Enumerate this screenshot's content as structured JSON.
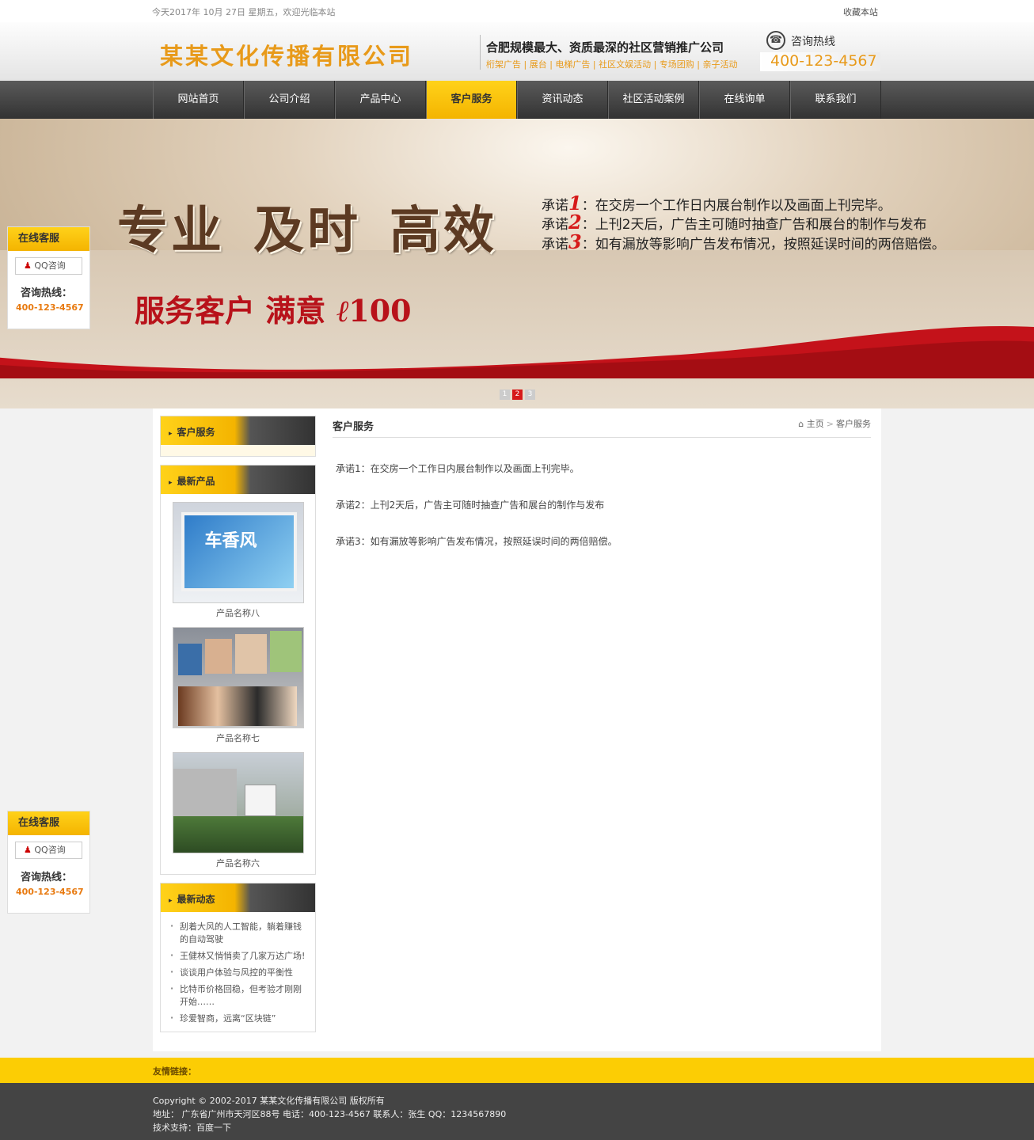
{
  "topbar": {
    "welcome": "今天2017年 10月 27日 星期五，欢迎光临本站",
    "favorite": "收藏本站"
  },
  "header": {
    "logo": "某某文化传播有限公司",
    "slogan_main": "合肥规模最大、资质最深的社区营销推广公司",
    "slogan_sub": "桁架广告 | 展台 | 电梯广告 | 社区文娱活动 | 专场团购 | 亲子活动",
    "hotline_label": "咨询热线",
    "hotline_number": "400-123-4567"
  },
  "nav": [
    "网站首页",
    "公司介绍",
    "产品中心",
    "客户服务",
    "资讯动态",
    "社区活动案例",
    "在线询单",
    "联系我们"
  ],
  "nav_active": "客户服务",
  "banner": {
    "big_words": [
      "专业",
      "及时",
      "高效"
    ],
    "promise_prefix": "承诺",
    "promises": [
      {
        "n": "1",
        "text": "：在交房一个工作日内展台制作以及画面上刊完毕。"
      },
      {
        "n": "2",
        "text": "：上刊2天后，广告主可随时抽查广告和展台的制作与发布"
      },
      {
        "n": "3",
        "text": "：如有漏放等影响广告发布情况，按照延误时间的两倍赔偿。"
      }
    ],
    "serve_slogan": "服务客户 满意",
    "serve_score": "100",
    "slides": [
      "1",
      "2",
      "3"
    ],
    "active_slide": 2
  },
  "float_service": {
    "title": "在线客服",
    "qq": "QQ咨询",
    "hotline_label": "咨询热线：",
    "hotline": "400-123-4567"
  },
  "sidebar": {
    "service_title": "客户服务",
    "products_title": "最新产品",
    "products": [
      {
        "name": "产品名称八"
      },
      {
        "name": "产品名称七"
      },
      {
        "name": "产品名称六"
      }
    ],
    "news_title": "最新动态",
    "news": [
      "刮着大风的人工智能，躺着赚钱的自动驾驶",
      "王健林又悄悄卖了几家万达广场!",
      "谈谈用户体验与风控的平衡性",
      "比特币价格回稳，但考验才刚刚开始……",
      "珍爱智商，远离“区块链”"
    ]
  },
  "content": {
    "title": "客户服务",
    "breadcrumb": {
      "home": "主页",
      "sep": ">",
      "current": "客户服务"
    },
    "paragraphs": [
      "承诺1：在交房一个工作日内展台制作以及画面上刊完毕。",
      "承诺2：上刊2天后，广告主可随时抽查广告和展台的制作与发布",
      "承诺3：如有漏放等影响广告发布情况，按照延误时间的两倍赔偿。"
    ]
  },
  "footer": {
    "friend_links": "友情链接：",
    "copyright": "Copyright © 2002-2017 某某文化传播有限公司 版权所有",
    "address": "地址： 广东省广州市天河区88号 电话：400-123-4567    联系人：张生       QQ：1234567890",
    "support": "技术支持：百度一下"
  },
  "colors": {
    "accent": "#f4b400",
    "orange": "#e89a1a",
    "red": "#d61a1a",
    "nav_dark": "#3c3c3c"
  }
}
